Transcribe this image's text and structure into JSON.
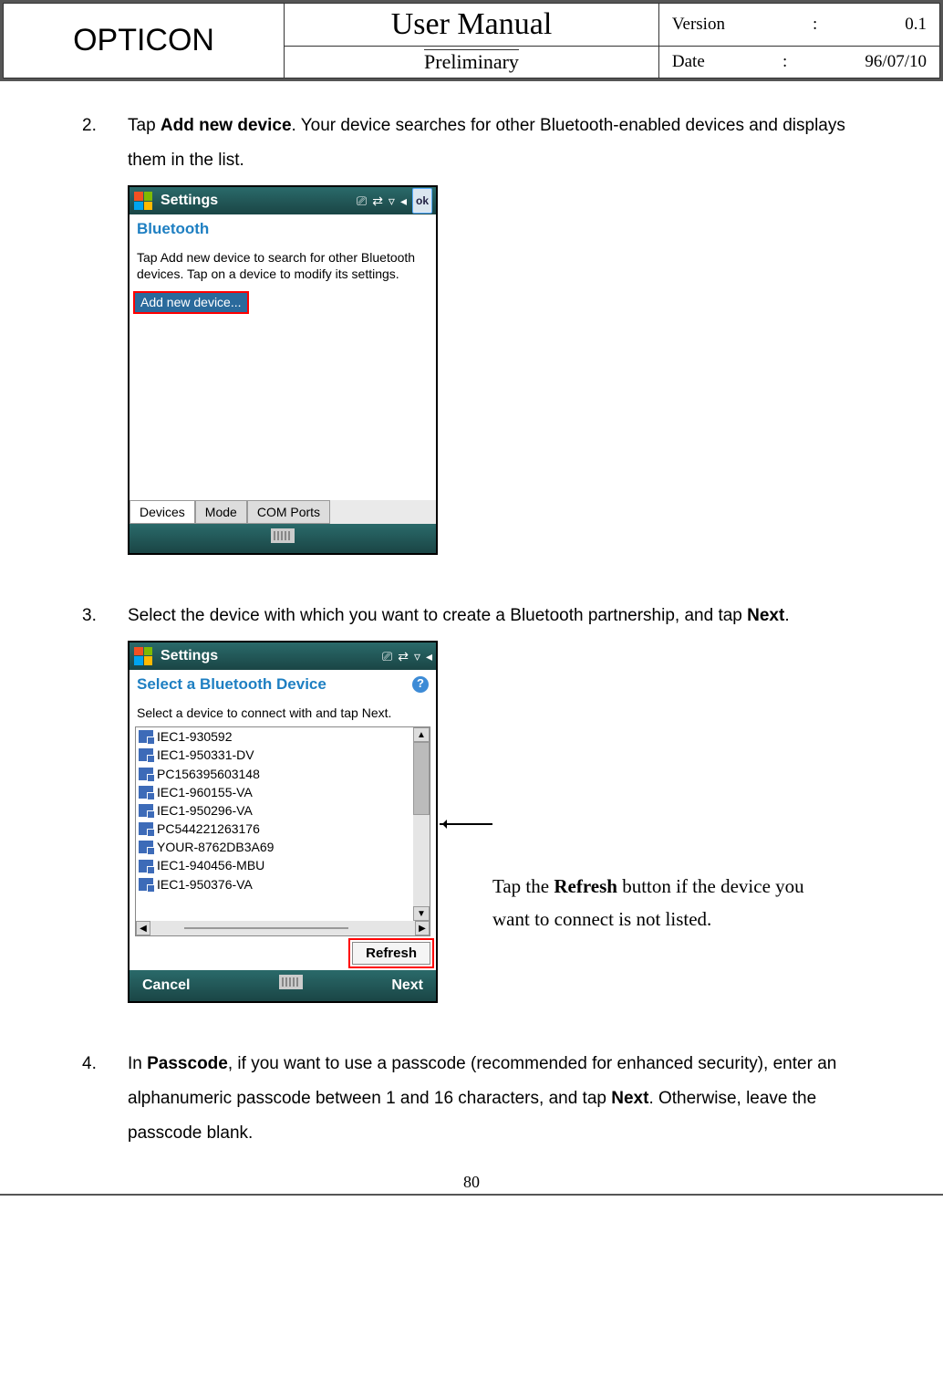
{
  "header": {
    "brand": "OPTICON",
    "title": "User Manual",
    "subtitle": "Preliminary",
    "version_label": "Version",
    "version_value": "0.1",
    "date_label": "Date",
    "date_value": "96/07/10"
  },
  "steps": {
    "s2": {
      "num": "2.",
      "pre": "Tap ",
      "bold": "Add new device",
      "post": ". Your device searches for other Bluetooth-enabled devices and displays them in the list."
    },
    "s3": {
      "num": "3.",
      "text_pre": "Select the device with which you want to create a Bluetooth partnership, and tap ",
      "bold": "Next",
      "post": "."
    },
    "s4": {
      "num": "4.",
      "pre": "In ",
      "b1": "Passcode",
      "mid": ", if you want to use a passcode (recommended for enhanced security), enter an alphanumeric passcode between 1 and 16 characters, and tap ",
      "b2": "Next",
      "post": ". Otherwise, leave the passcode blank."
    }
  },
  "screenshot1": {
    "titlebar_title": "Settings",
    "ok": "ok",
    "section": "Bluetooth",
    "instruction": "Tap Add new device to search for other Bluetooth devices. Tap on a device to modify its settings.",
    "highlight": "Add new device...",
    "tabs": [
      "Devices",
      "Mode",
      "COM Ports"
    ]
  },
  "screenshot2": {
    "titlebar_title": "Settings",
    "section": "Select a Bluetooth Device",
    "instruction": "Select a device to connect with and tap Next.",
    "devices": [
      "IEC1-930592",
      "IEC1-950331-DV",
      "PC156395603148",
      "IEC1-960155-VA",
      "IEC1-950296-VA",
      "PC544221263176",
      "YOUR-8762DB3A69",
      "IEC1-940456-MBU",
      "IEC1-950376-VA"
    ],
    "refresh": "Refresh",
    "soft_left": "Cancel",
    "soft_right": "Next"
  },
  "side_note": {
    "pre": "Tap the ",
    "bold": "Refresh",
    "post": " button if the device you want to connect is not listed."
  },
  "page_number": "80"
}
